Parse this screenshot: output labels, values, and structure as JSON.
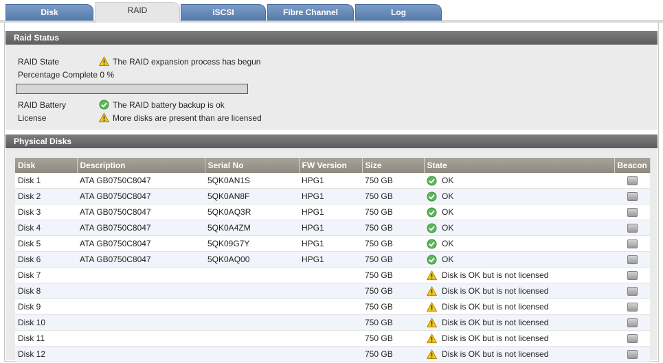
{
  "tabs": [
    {
      "label": "Disk",
      "active": false
    },
    {
      "label": "RAID",
      "active": true
    },
    {
      "label": "iSCSI",
      "active": false
    },
    {
      "label": "Fibre Channel",
      "active": false
    },
    {
      "label": "Log",
      "active": false
    }
  ],
  "raid_status": {
    "header": "Raid Status",
    "state_label": "RAID State",
    "state_value": "The RAID expansion process has begun",
    "state_icon": "warning-icon",
    "percentage_label": "Percentage Complete 0 %",
    "progress_fraction": 0,
    "battery_label": "RAID Battery",
    "battery_value": "The RAID battery backup is ok",
    "battery_icon": "ok-check-icon",
    "license_label": "License",
    "license_value": "More disks are present than are licensed",
    "license_icon": "warning-icon"
  },
  "physical_disks": {
    "header": "Physical Disks",
    "columns": [
      "Disk",
      "Description",
      "Serial No",
      "FW Version",
      "Size",
      "State",
      "Beacon"
    ],
    "rows": [
      {
        "disk": "Disk 1",
        "description": "ATA GB0750C8047",
        "serial": "5QK0AN1S",
        "fw": "HPG1",
        "size": "750 GB",
        "state": "OK",
        "state_icon": "ok-check-icon"
      },
      {
        "disk": "Disk 2",
        "description": "ATA GB0750C8047",
        "serial": "5QK0AN8F",
        "fw": "HPG1",
        "size": "750 GB",
        "state": "OK",
        "state_icon": "ok-check-icon"
      },
      {
        "disk": "Disk 3",
        "description": "ATA GB0750C8047",
        "serial": "5QK0AQ3R",
        "fw": "HPG1",
        "size": "750 GB",
        "state": "OK",
        "state_icon": "ok-check-icon"
      },
      {
        "disk": "Disk 4",
        "description": "ATA GB0750C8047",
        "serial": "5QK0A4ZM",
        "fw": "HPG1",
        "size": "750 GB",
        "state": "OK",
        "state_icon": "ok-check-icon"
      },
      {
        "disk": "Disk 5",
        "description": "ATA GB0750C8047",
        "serial": "5QK09G7Y",
        "fw": "HPG1",
        "size": "750 GB",
        "state": "OK",
        "state_icon": "ok-check-icon"
      },
      {
        "disk": "Disk 6",
        "description": "ATA GB0750C8047",
        "serial": "5QK0AQ00",
        "fw": "HPG1",
        "size": "750 GB",
        "state": "OK",
        "state_icon": "ok-check-icon"
      },
      {
        "disk": "Disk 7",
        "description": "",
        "serial": "",
        "fw": "",
        "size": "750 GB",
        "state": "Disk is OK but is not licensed",
        "state_icon": "warning-icon"
      },
      {
        "disk": "Disk 8",
        "description": "",
        "serial": "",
        "fw": "",
        "size": "750 GB",
        "state": "Disk is OK but is not licensed",
        "state_icon": "warning-icon"
      },
      {
        "disk": "Disk 9",
        "description": "",
        "serial": "",
        "fw": "",
        "size": "750 GB",
        "state": "Disk is OK but is not licensed",
        "state_icon": "warning-icon"
      },
      {
        "disk": "Disk 10",
        "description": "",
        "serial": "",
        "fw": "",
        "size": "750 GB",
        "state": "Disk is OK but is not licensed",
        "state_icon": "warning-icon"
      },
      {
        "disk": "Disk 11",
        "description": "",
        "serial": "",
        "fw": "",
        "size": "750 GB",
        "state": "Disk is OK but is not licensed",
        "state_icon": "warning-icon"
      },
      {
        "disk": "Disk 12",
        "description": "",
        "serial": "",
        "fw": "",
        "size": "750 GB",
        "state": "Disk is OK but is not licensed",
        "state_icon": "warning-icon"
      }
    ]
  },
  "colors": {
    "tab_blue": "#557aa9",
    "section_header": "#6b6b6b",
    "table_header": "#9c958b",
    "ok_green": "#4caf50",
    "warning_yellow": "#f2c200"
  }
}
